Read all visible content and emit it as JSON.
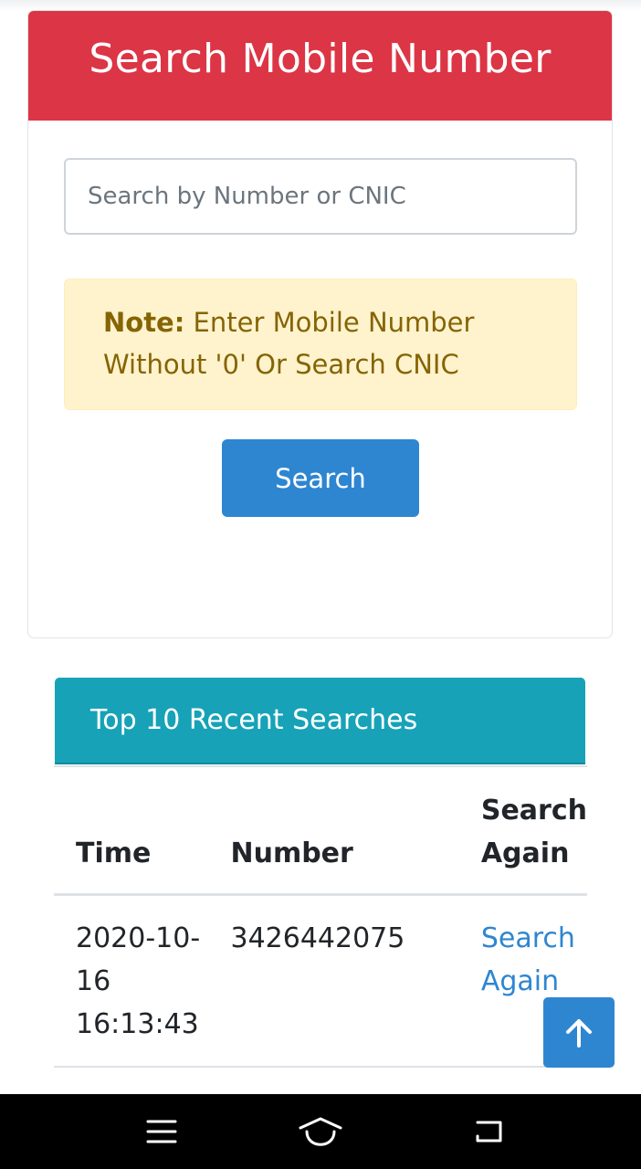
{
  "search_card": {
    "title": "Search Mobile Number",
    "input_placeholder": "Search by Number or CNIC",
    "input_value": "",
    "note_label": "Note:",
    "note_text": " Enter Mobile Number Without '0' Or Search CNIC",
    "search_button_label": "Search"
  },
  "recent_searches": {
    "title": "Top 10 Recent Searches",
    "columns": [
      "Time",
      "Number",
      "Search Again"
    ],
    "rows": [
      {
        "time": "2020-10-16 16:13:43",
        "number": "3426442075",
        "action_label": "Search Again"
      }
    ]
  },
  "scroll_top": {
    "icon": "arrow-up-icon"
  },
  "nav_bar": {
    "icons": [
      "menu-icon",
      "home-icon",
      "back-icon"
    ]
  },
  "colors": {
    "header_red": "#dc3545",
    "note_bg": "#fff3cd",
    "note_text": "#856404",
    "primary_blue": "#2e86d1",
    "recent_header_teal": "#17a2b8"
  }
}
